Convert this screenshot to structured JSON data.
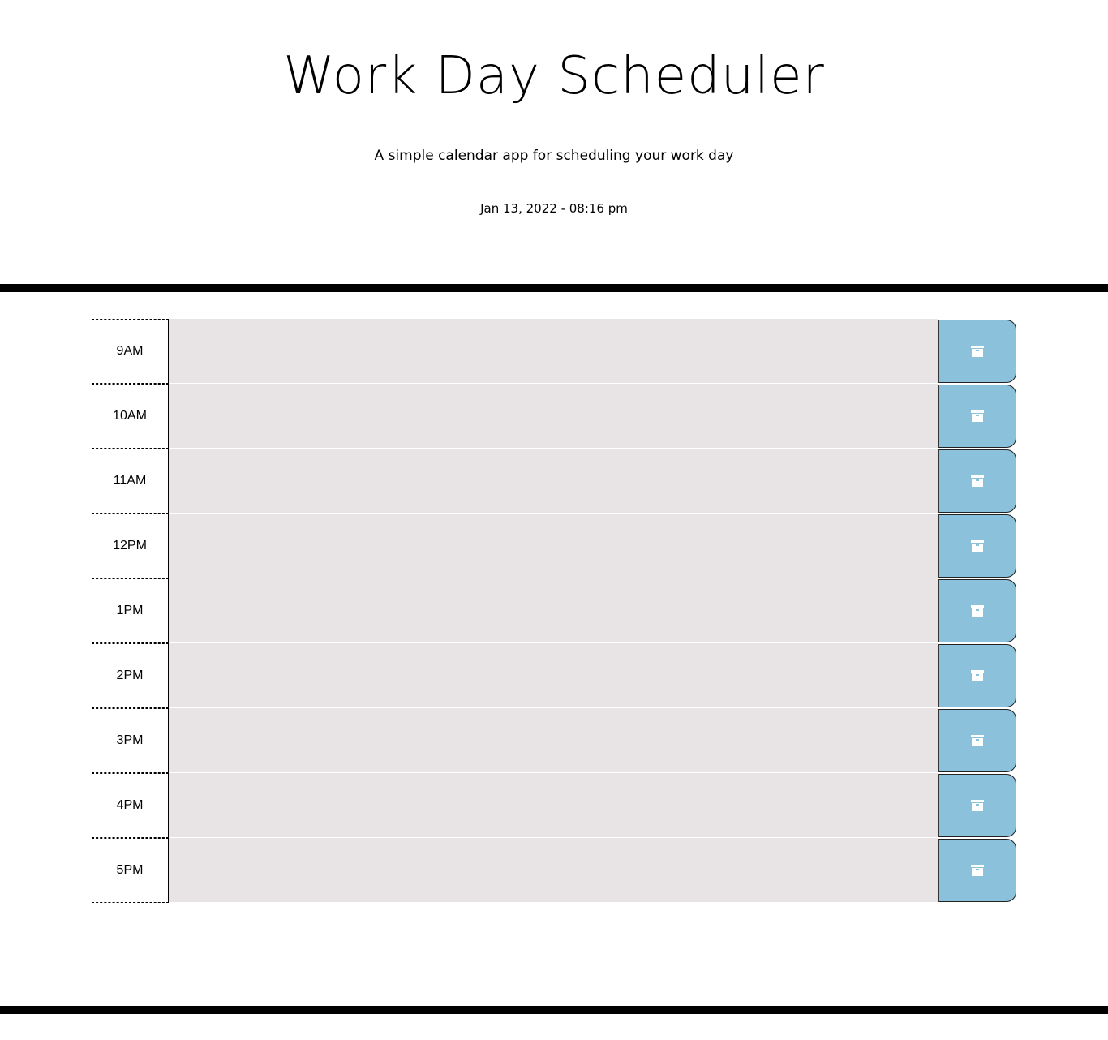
{
  "header": {
    "title": "Work Day Scheduler",
    "subtitle": "A simple calendar app for scheduling your work day",
    "datetime": "Jan 13, 2022 - 08:16 pm"
  },
  "colors": {
    "event_bg": "#e8e4e6",
    "save_bg": "#8bc1da",
    "rule": "#000000"
  },
  "rows": [
    {
      "hour": "9AM",
      "text": ""
    },
    {
      "hour": "10AM",
      "text": ""
    },
    {
      "hour": "11AM",
      "text": ""
    },
    {
      "hour": "12PM",
      "text": ""
    },
    {
      "hour": "1PM",
      "text": ""
    },
    {
      "hour": "2PM",
      "text": ""
    },
    {
      "hour": "3PM",
      "text": ""
    },
    {
      "hour": "4PM",
      "text": ""
    },
    {
      "hour": "5PM",
      "text": ""
    }
  ],
  "save_icon": "save-icon"
}
